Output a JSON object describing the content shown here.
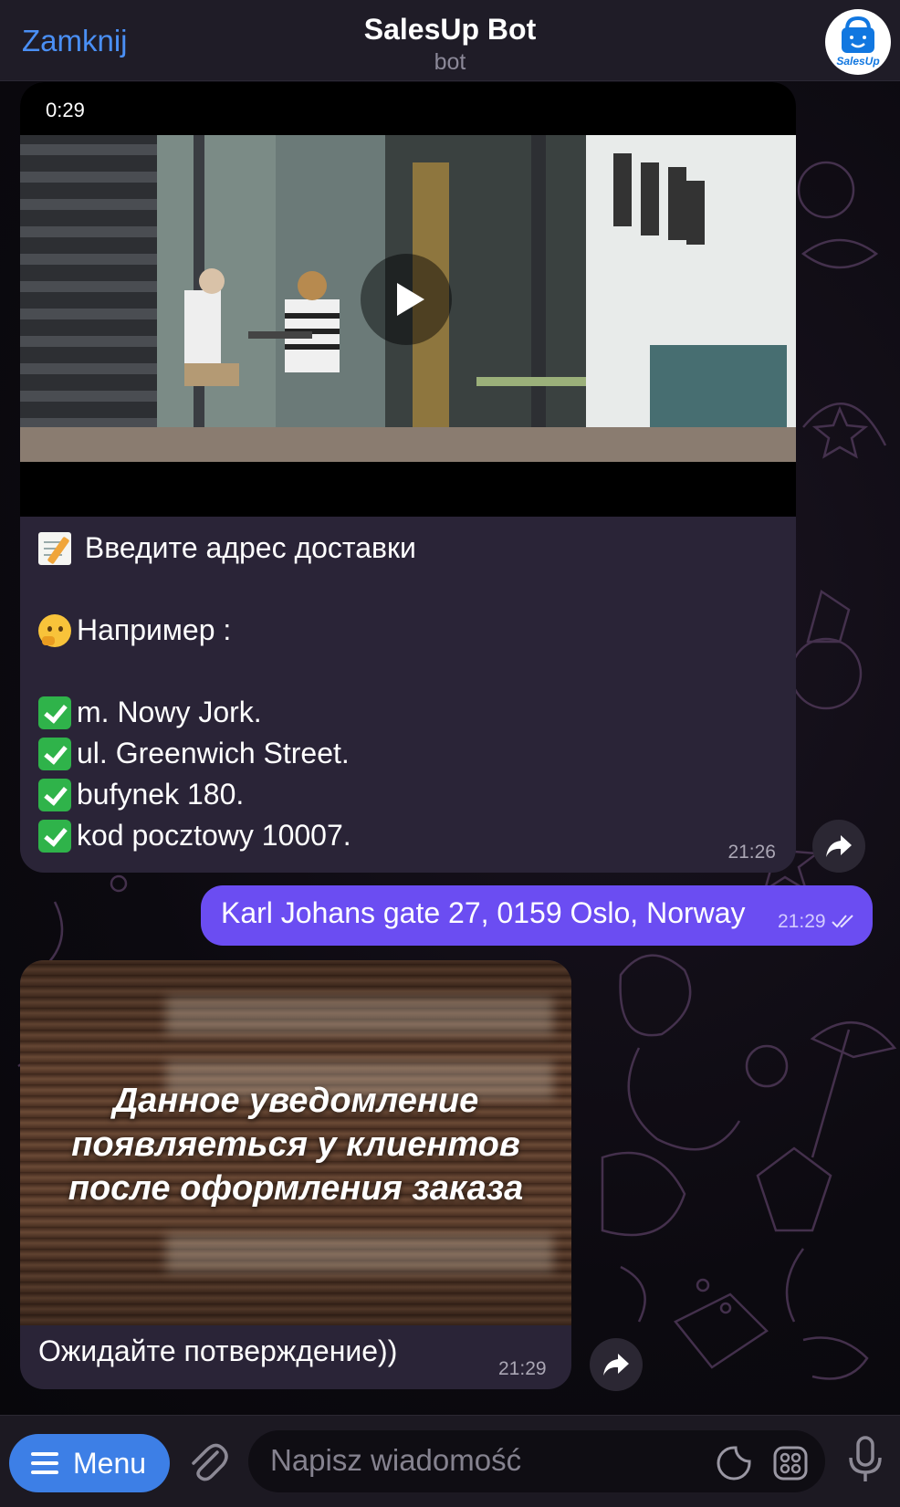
{
  "header": {
    "close_label": "Zamknij",
    "title": "SalesUp Bot",
    "subtitle": "bot",
    "avatar_label": "SalesUp"
  },
  "messages": {
    "first": {
      "video_duration": "0:29",
      "lines": [
        "Введите адрес доставки",
        "",
        "Например :",
        "",
        "m. Nowy Jork.",
        "ul. Greenwich Street.",
        "bufynek 180.",
        "kod pocztowy 10007."
      ],
      "time": "21:26"
    },
    "outgoing": {
      "text": "Karl Johans gate 27, 0159 Oslo, Norway",
      "time": "21:29"
    },
    "second": {
      "image_caption": "Данное уведомление появляеться у клиентов после оформления заказа",
      "text": "Ожидайте потверждение))",
      "time": "21:29"
    }
  },
  "composer": {
    "menu_label": "Menu",
    "placeholder": "Napisz wiadomość"
  },
  "colors": {
    "accent": "#4a8ff5",
    "outgoing_bubble": "#6b4df2",
    "incoming_bubble": "#2a2437",
    "menu_button": "#3d7fe6"
  },
  "icons": [
    "attach-icon",
    "sticker-icon",
    "keyboard-grid-icon",
    "microphone-icon",
    "forward-icon",
    "play-icon",
    "read-checks-icon"
  ]
}
